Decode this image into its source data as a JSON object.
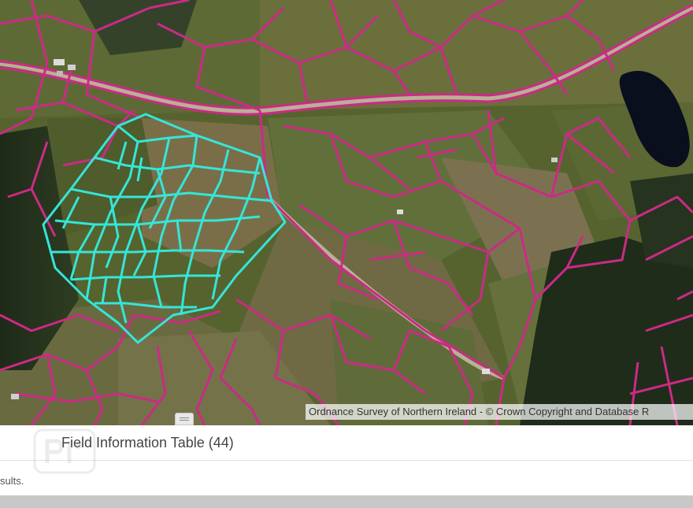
{
  "map": {
    "attribution": "Ordnance Survey of Northern Ireland - © Crown Copyright and Database R",
    "boundary_color": "#cc2a86",
    "selected_color": "#34e6d8"
  },
  "panel": {
    "title": "Field Information Table (44)",
    "results_text": "sults."
  }
}
